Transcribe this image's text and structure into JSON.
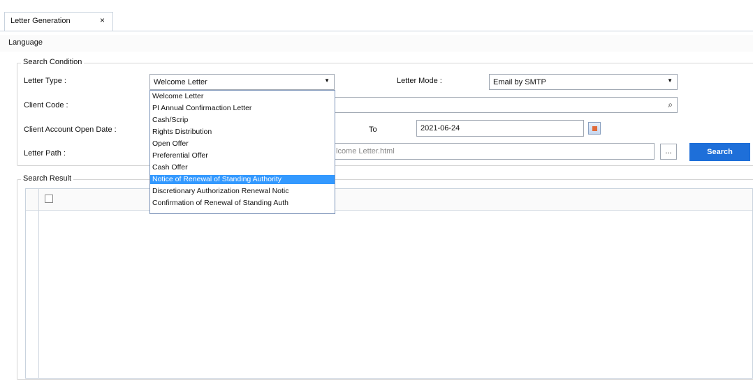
{
  "tab": {
    "label": "Letter Generation",
    "close": "×"
  },
  "menu": {
    "language": "Language"
  },
  "search_condition": {
    "title": "Search Condition",
    "letter_type_label": "Letter Type :",
    "letter_type_value": "Welcome Letter",
    "letter_mode_label": "Letter Mode :",
    "letter_mode_value": "Email by SMTP",
    "client_code_label": "Client Code :",
    "open_date_label": "Client Account Open Date :",
    "to_label": "To",
    "to_date": "2021-06-24",
    "letter_path_label": "Letter Path :",
    "letter_path_value": "lcome Letter.html",
    "browse_label": "...",
    "search_button": "Search"
  },
  "dropdown_options": [
    "Welcome Letter",
    "PI Annual Confirmaction Letter",
    "Cash/Scrip",
    "Rights Distribution",
    "Open Offer",
    "Preferential Offer",
    "Cash Offer",
    "Notice of Renewal of Standing Authority",
    "Discretionary Authorization Renewal Notic",
    "Confirmation of Renewal of Standing Auth"
  ],
  "selected_option_index": 7,
  "search_result": {
    "title": "Search Result"
  },
  "colors": {
    "accent": "#1e6fd9",
    "selection": "#3399ff"
  }
}
